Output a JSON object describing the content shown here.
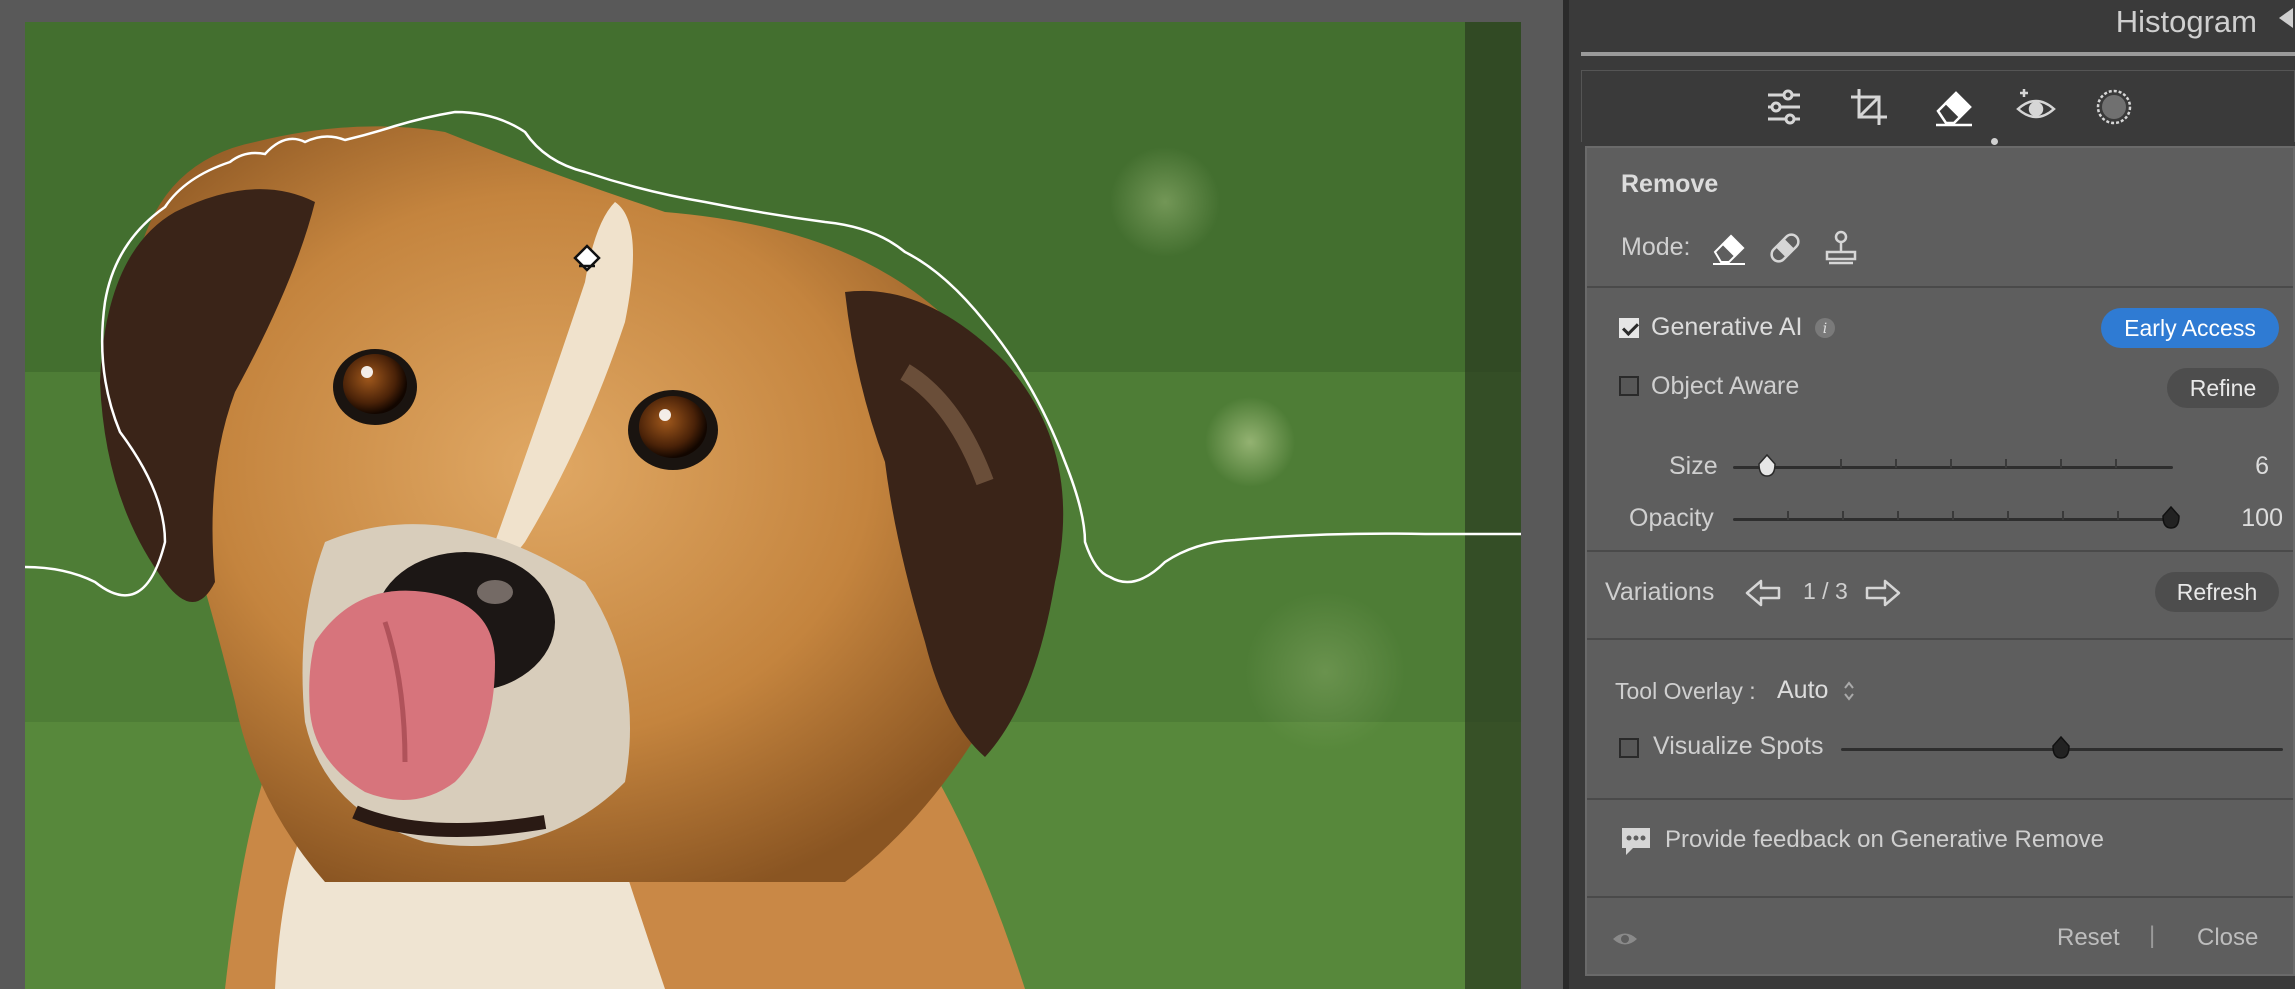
{
  "histogram": {
    "title": "Histogram"
  },
  "tools": [
    {
      "icon": "edit-sliders-icon"
    },
    {
      "icon": "crop-icon"
    },
    {
      "icon": "remove-eraser-icon",
      "active": true
    },
    {
      "icon": "red-eye-icon"
    },
    {
      "icon": "masking-icon"
    }
  ],
  "remove": {
    "title": "Remove",
    "mode_label": "Mode:",
    "modes": [
      "remove-eraser-icon",
      "heal-bandage-icon",
      "clone-stamp-icon"
    ],
    "generative_ai": {
      "label": "Generative AI",
      "checked": true,
      "badge": "Early Access"
    },
    "object_aware": {
      "label": "Object Aware",
      "checked": false,
      "refine": "Refine"
    },
    "size": {
      "label": "Size",
      "value": "6",
      "fraction": 0.07
    },
    "opacity": {
      "label": "Opacity",
      "value": "100",
      "fraction": 1.0
    },
    "variations": {
      "label": "Variations",
      "counter": "1 / 3",
      "refresh": "Refresh"
    },
    "tool_overlay": {
      "label": "Tool Overlay :",
      "value": "Auto"
    },
    "visualize_spots": {
      "label": "Visualize Spots",
      "checked": false,
      "fraction": 0.5
    },
    "feedback": "Provide feedback on Generative Remove",
    "footer": {
      "reset": "Reset",
      "separator": "|",
      "close": "Close"
    }
  },
  "colors": {
    "accent": "#2f7bd3",
    "panel": "#5e5e5e",
    "background": "#3a3a3a"
  }
}
